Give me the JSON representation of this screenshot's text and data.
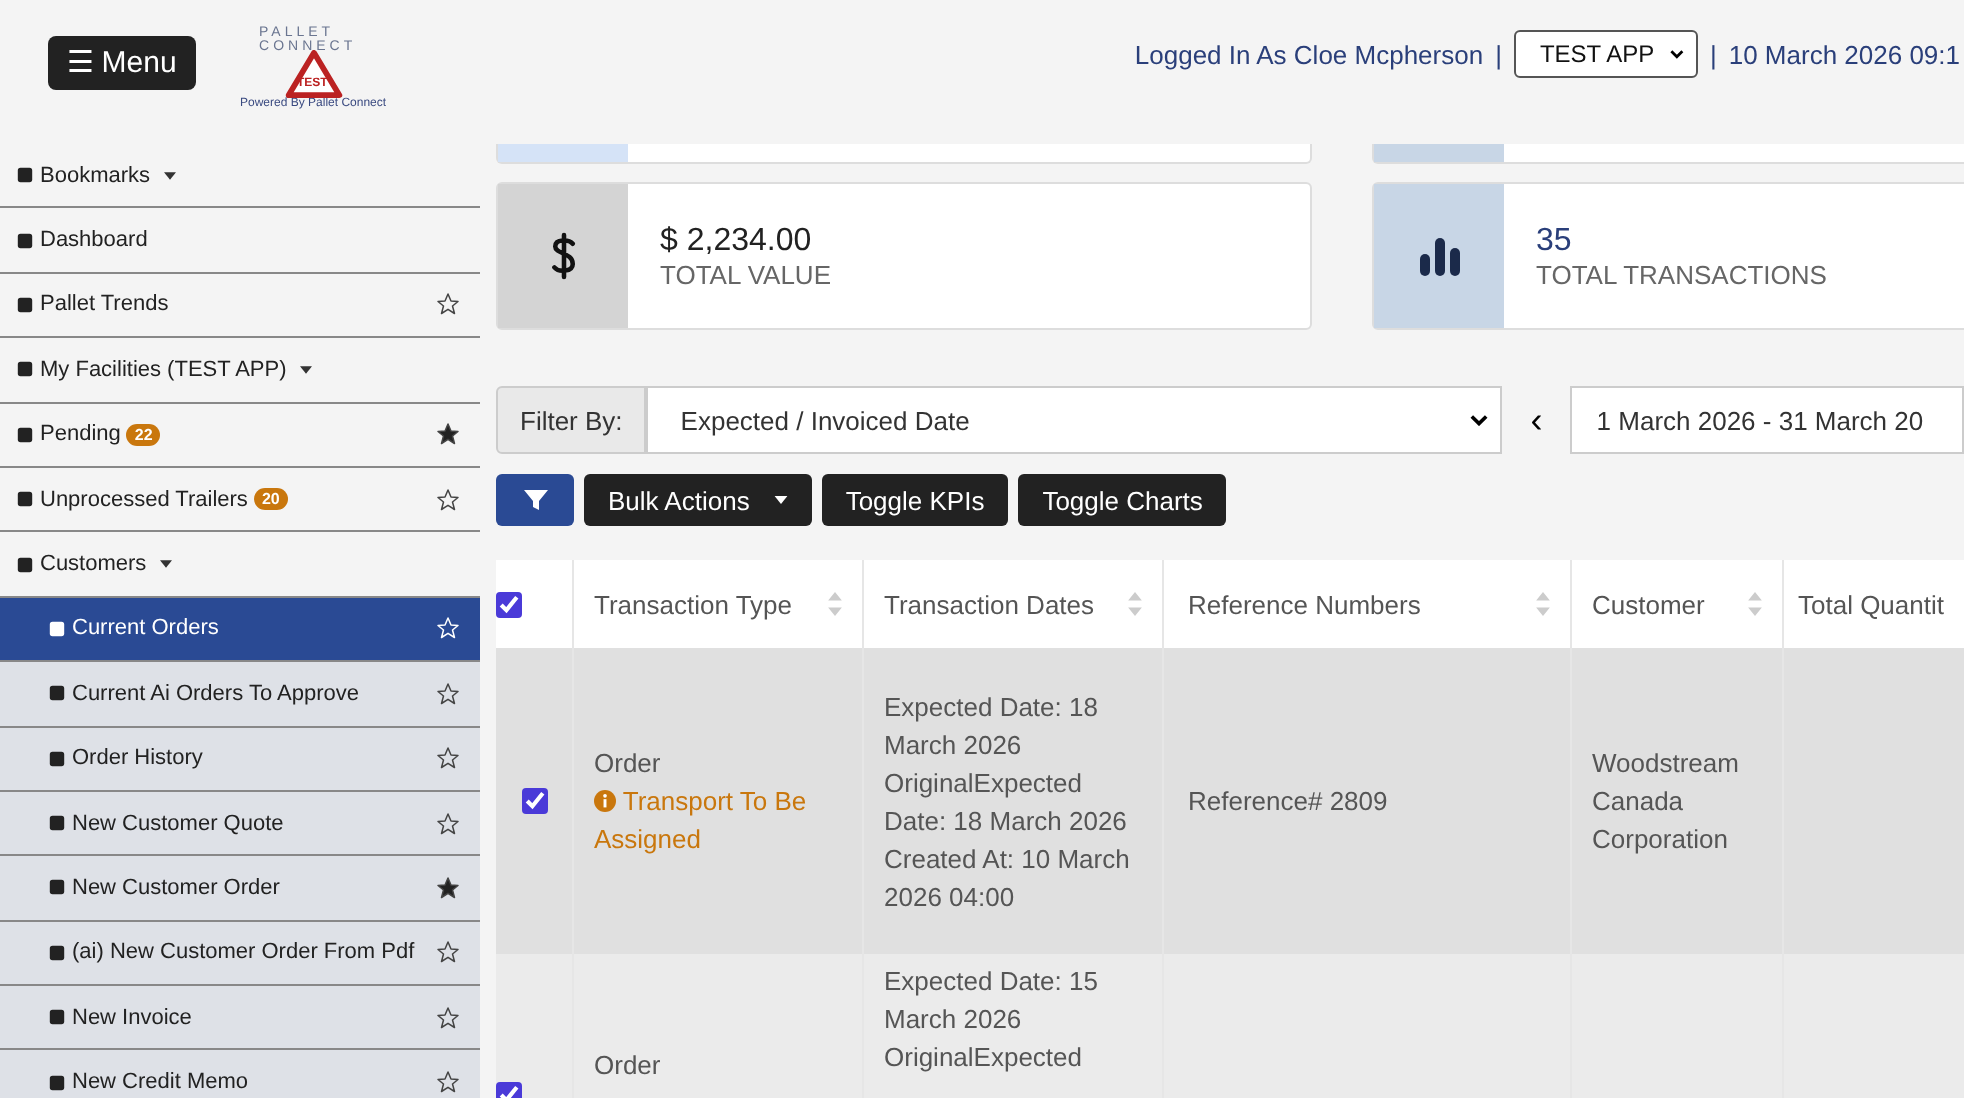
{
  "header": {
    "menu_button": "☰ Menu",
    "logo": {
      "wordmark_top": "PALLET",
      "wordmark_bottom": "CONNECT",
      "badge": "TEST",
      "tagline": "Powered By Pallet Connect"
    },
    "user_text": "Logged In As Cloe Mcpherson",
    "separator_1": "|",
    "app_select": "TEST APP",
    "separator_2": "|",
    "date_time": "10 March 2026 09:1"
  },
  "sidebar": {
    "items": [
      {
        "label": "Bookmarks",
        "dropdown": true,
        "selected": false
      },
      {
        "label": "Dashboard",
        "selected": false
      },
      {
        "label": "Pallet Trends",
        "starred": false,
        "selected": false
      },
      {
        "label": "My Facilities (TEST APP)",
        "dropdown": true,
        "selected": false
      },
      {
        "label": "Pending",
        "badge": "22",
        "starred": true,
        "selected": false
      },
      {
        "label": "Unprocessed Trailers",
        "badge": "20",
        "starred": false,
        "selected": false
      },
      {
        "label": "Customers",
        "dropdown": true,
        "selected": false,
        "children": [
          {
            "label": "Current Orders",
            "starred": false,
            "selected": true
          },
          {
            "label": "Current Ai Orders To Approve",
            "starred": false,
            "selected": false
          },
          {
            "label": "Order History",
            "starred": false,
            "selected": false
          },
          {
            "label": "New Customer Quote",
            "starred": false,
            "selected": false
          },
          {
            "label": "New Customer Order",
            "starred": true,
            "selected": false
          },
          {
            "label": "(ai) New Customer Order From Pdf",
            "starred": false,
            "selected": false
          },
          {
            "label": "New Invoice",
            "starred": false,
            "selected": false
          },
          {
            "label": "New Credit Memo",
            "starred": false,
            "selected": false
          }
        ]
      }
    ]
  },
  "kpis": [
    {
      "value": "$ 2,234.00",
      "label": "TOTAL VALUE"
    },
    {
      "value": "35",
      "label": "TOTAL TRANSACTIONS"
    }
  ],
  "filter": {
    "label": "Filter By:",
    "select": "Expected / Invoiced Date",
    "prev": "‹",
    "date_range": "1 March 2026 - 31 March 20"
  },
  "actions": [
    {
      "kind": "filter"
    },
    {
      "kind": "dropdown",
      "label": "Bulk Actions"
    },
    {
      "kind": "plain",
      "label": "Toggle KPIs"
    },
    {
      "kind": "plain",
      "label": "Toggle Charts"
    }
  ],
  "table": {
    "select_all_checked": true,
    "columns": [
      {
        "label": "Transaction Type",
        "sortable": true
      },
      {
        "label": "Transaction Dates",
        "sortable": true
      },
      {
        "label": "Reference Numbers",
        "sortable": true
      },
      {
        "label": "Customer",
        "sortable": true
      },
      {
        "label": "Total Quantit"
      }
    ],
    "rows": [
      {
        "checked": true,
        "type": "Order",
        "status": "Transport To Be Assigned",
        "dates": "Expected Date: 18 March 2026 OriginalExpected Date: 18 March 2026 Created At: 10 March 2026 04:00",
        "reference": "Reference# 2809",
        "customer": "Woodstream Canada Corporation"
      },
      {
        "checked": true,
        "type": "Order",
        "dates": "Expected Date: 15 March 2026 OriginalExpected"
      }
    ]
  }
}
